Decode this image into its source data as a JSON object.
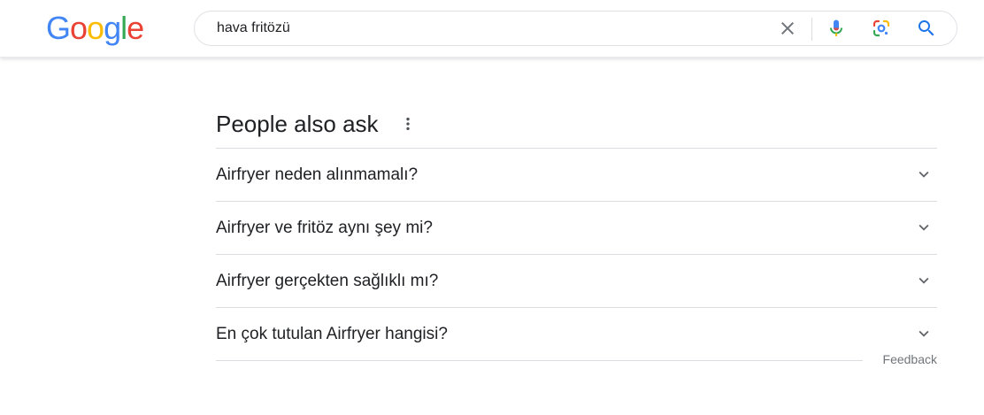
{
  "header": {
    "logo": {
      "letters": [
        {
          "char": "G",
          "color": "#4285F4"
        },
        {
          "char": "o",
          "color": "#EA4335"
        },
        {
          "char": "o",
          "color": "#FBBC05"
        },
        {
          "char": "g",
          "color": "#4285F4"
        },
        {
          "char": "l",
          "color": "#34A853"
        },
        {
          "char": "e",
          "color": "#EA4335"
        }
      ]
    },
    "search": {
      "value": "hava fritözü"
    },
    "icons": {
      "clear": "close-icon",
      "mic": "microphone-icon",
      "lens": "google-lens-icon",
      "search": "search-icon"
    }
  },
  "paa": {
    "title": "People also ask",
    "questions": [
      {
        "text": "Airfryer neden alınmamalı?"
      },
      {
        "text": "Airfryer ve fritöz aynı şey mi?"
      },
      {
        "text": "Airfryer gerçekten sağlıklı mı?"
      },
      {
        "text": "En çok tutulan Airfryer hangisi?"
      }
    ],
    "feedback_label": "Feedback"
  },
  "colors": {
    "blue": "#4285F4",
    "red": "#EA4335",
    "yellow": "#FBBC05",
    "green": "#34A853",
    "search_icon": "#1a73e8",
    "text": "#202124",
    "secondary": "#70757a"
  }
}
